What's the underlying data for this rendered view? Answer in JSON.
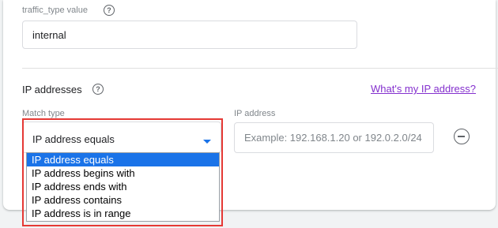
{
  "traffic_type": {
    "label": "traffic_type value",
    "help_icon": "help-circle-icon",
    "value": "internal"
  },
  "ip_section": {
    "title": "IP addresses",
    "help_icon": "help-circle-icon",
    "link_text": "What's my IP address?",
    "match_type": {
      "label": "Match type",
      "selected": "IP address equals",
      "options": [
        "IP address equals",
        "IP address begins with",
        "IP address ends with",
        "IP address contains",
        "IP address is in range"
      ],
      "selected_index": 0
    },
    "ip_address": {
      "label": "IP address",
      "placeholder": "Example: 192.168.1.20 or 192.0.2.0/24"
    },
    "remove_icon": "remove-circle-icon"
  },
  "colors": {
    "link": "#8430ce",
    "accent": "#1a73e8",
    "highlight_border": "#e53935"
  }
}
